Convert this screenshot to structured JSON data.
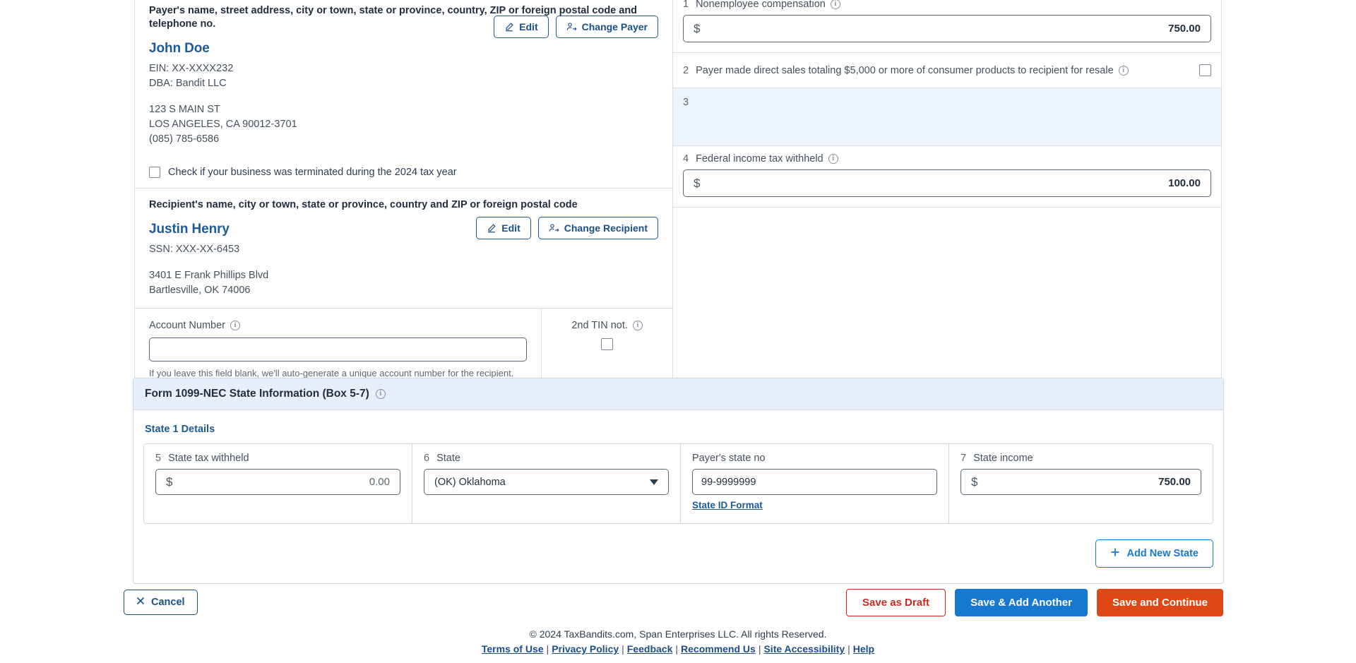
{
  "payer_section": {
    "caption": "Payer's name, street address, city or town, state or province, country, ZIP or foreign postal code and telephone no.",
    "name": "John Doe",
    "ein": "EIN: XX-XXXX232",
    "dba": "DBA: Bandit LLC",
    "address_line1": "123 S MAIN ST",
    "address_line2": "LOS ANGELES, CA 90012-3701",
    "phone": "(085) 785-6586",
    "edit_label": "Edit",
    "change_label": "Change Payer",
    "terminated_checkbox_label": "Check if your business was terminated during the 2024 tax year"
  },
  "recipient_section": {
    "caption": "Recipient's name, city or town, state or province, country and ZIP or foreign postal code",
    "name": "Justin Henry",
    "ssn": "SSN: XXX-XX-6453",
    "address_line1": "3401 E Frank Phillips Blvd",
    "address_line2": "Bartlesville, OK 74006",
    "edit_label": "Edit",
    "change_label": "Change Recipient"
  },
  "account_section": {
    "label": "Account Number",
    "value": "",
    "hint": "If you leave this field blank, we'll auto-generate a unique account number for the recipient.",
    "tin_label": "2nd TIN not.",
    "tin_checked": false
  },
  "boxes": {
    "box1": {
      "number": "1",
      "label": "Nonemployee compensation",
      "currency": "$",
      "value": "750.00"
    },
    "box2": {
      "number": "2",
      "label": "Payer made direct sales totaling $5,000 or more of consumer products to recipient for resale",
      "checked": false
    },
    "box3": {
      "number": "3",
      "label": ""
    },
    "box4": {
      "number": "4",
      "label": "Federal income tax withheld",
      "currency": "$",
      "value": "100.00"
    }
  },
  "state_section": {
    "title": "Form 1099-NEC  State Information  (Box 5-7)",
    "subtitle": "State 1 Details",
    "box5": {
      "number": "5",
      "label": "State tax withheld",
      "currency": "$",
      "value": "0.00"
    },
    "box6": {
      "number": "6",
      "label": "State",
      "value": "(OK) Oklahoma"
    },
    "payer_state_no": {
      "label": "Payer's state no",
      "value": "99-9999999",
      "format_link": "State ID Format"
    },
    "box7": {
      "number": "7",
      "label": "State income",
      "currency": "$",
      "value": "750.00"
    },
    "add_new_state_label": "Add New State",
    "add_icon": "plus-icon"
  },
  "actions": {
    "cancel_label": "Cancel",
    "save_draft_label": "Save as Draft",
    "save_add_another_label": "Save & Add Another",
    "save_continue_label": "Save and Continue"
  },
  "footer": {
    "copyright": "© 2024 TaxBandits.com, Span Enterprises LLC. All rights Reserved.",
    "links": [
      "Terms of Use",
      "Privacy Policy",
      "Feedback",
      "Recommend Us",
      "Site Accessibility",
      "Help"
    ],
    "separator": "|"
  },
  "colors": {
    "brand_blue": "#1d5a96",
    "action_blue": "#1778d0",
    "action_orange": "#dd4814",
    "draft_red": "#c62c20",
    "panel_blue": "#e7f0fa",
    "box3_fill": "#eef4fb"
  }
}
